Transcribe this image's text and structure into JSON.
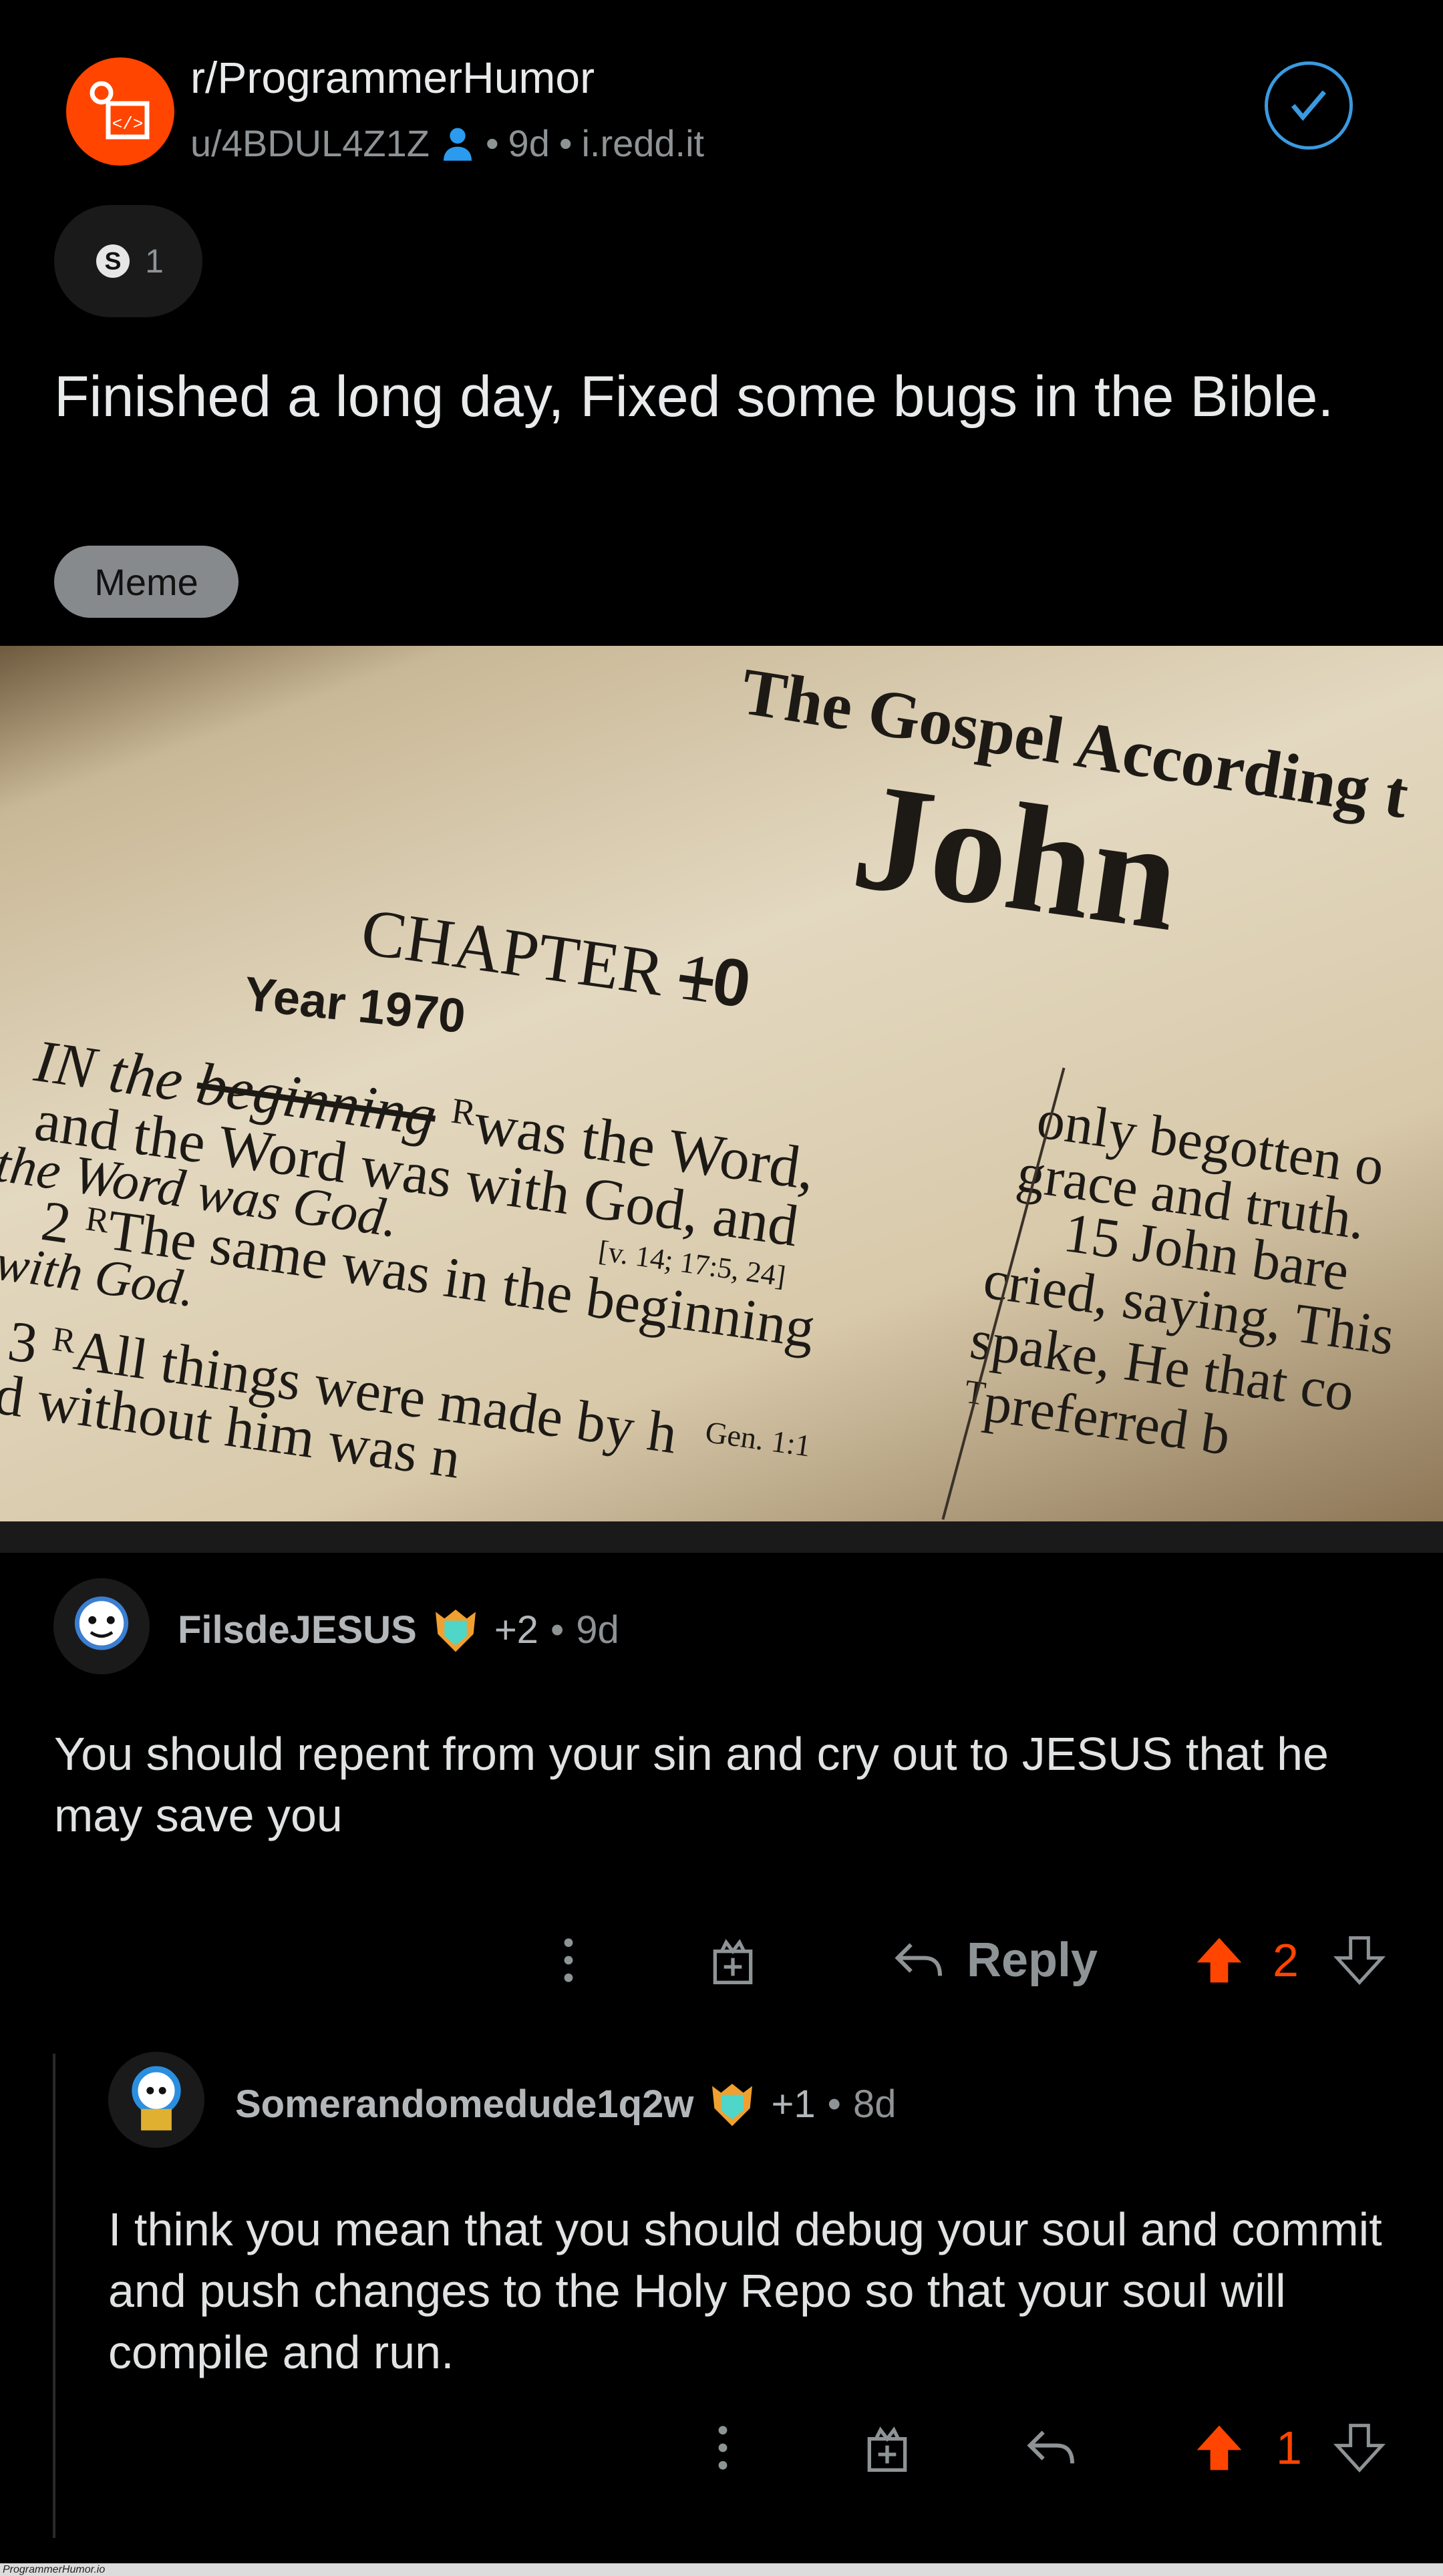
{
  "post": {
    "subreddit": "r/ProgrammerHumor",
    "author": "u/4BDUL4Z1Z",
    "age": "9d",
    "domain": "i.redd.it",
    "separator": "•",
    "award_count": "1",
    "title": "Finished a long day, Fixed some bugs in the Bible.",
    "flair": "Meme",
    "image_text": {
      "heading": "The Gospel According t",
      "book": "John",
      "chapter": "CHAPTER",
      "chapter_num_struck": "1",
      "chapter_num": "0",
      "year": "Year 1970",
      "line1": "IN the",
      "struck": "beginning",
      "line1b": "ᴿwas the Word,",
      "line2": "and the Word was with God, and",
      "line3": "the Word was God.",
      "ref1": "[v. 14; 17:5, 24]",
      "line4": "2 ᴿThe same was in the beginning",
      "line5": "with God.",
      "line6": "3 ᴿAll things were made by h",
      "ref2": "Gen. 1:1",
      "line7": "d without him was n",
      "r1": "only begotten o",
      "r2": "grace and truth.",
      "r3": "15 John bare",
      "r4": "cried, saying, This",
      "r5": "spake, He that co",
      "r6": "ᵀpreferred b"
    }
  },
  "comments": [
    {
      "username": "FilsdeJESUS",
      "points": "+2",
      "age": "9d",
      "text": "You should repent from your sin and cry out to JESUS that he may save you",
      "reply_label": "Reply",
      "votes": "2"
    },
    {
      "username": "Somerandomedude1q2w",
      "points": "+1",
      "age": "8d",
      "text": "I think you mean that you should debug your soul and commit and push changes to the Holy Repo so that your soul will compile and run.",
      "votes": "1"
    }
  ],
  "footer": {
    "watermark": "ProgrammerHumor.io"
  },
  "colors": {
    "accent": "#ff4500",
    "check": "#3a9ae0",
    "background": "#000000"
  }
}
